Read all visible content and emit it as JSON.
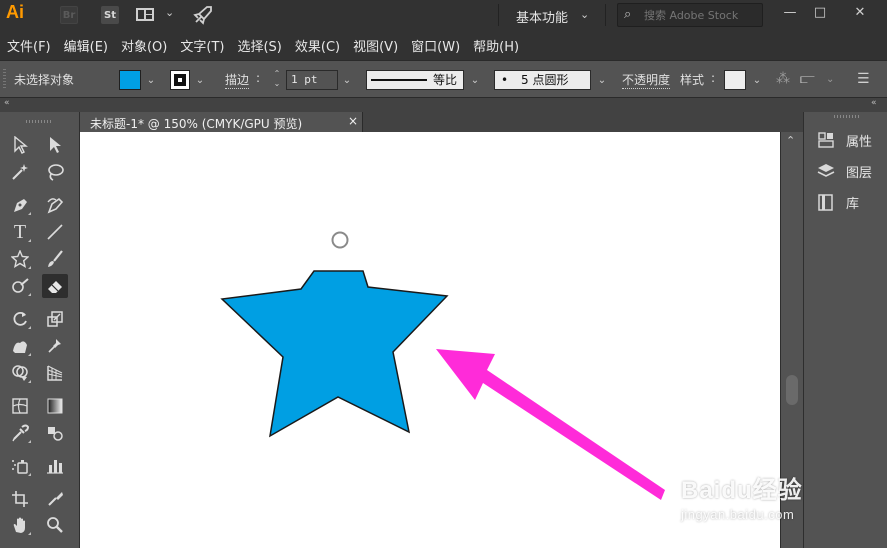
{
  "app": {
    "logo": "Ai",
    "bridge_label": "Br",
    "stock_label": "St",
    "workspace": "基本功能",
    "stock_search_placeholder": "搜索 Adobe Stock"
  },
  "menu": [
    "文件(F)",
    "编辑(E)",
    "对象(O)",
    "文字(T)",
    "选择(S)",
    "效果(C)",
    "视图(V)",
    "窗口(W)",
    "帮助(H)"
  ],
  "controlbar": {
    "selection_status": "未选择对象",
    "fill_color": "#009fe3",
    "stroke_label": "描边",
    "stroke_weight": "1 pt",
    "stroke_profile": "等比",
    "brush": "5 点圆形",
    "opacity_label": "不透明度",
    "style_label": "样式"
  },
  "document": {
    "tab_title": "未标题-1* @ 150% (CMYK/GPU 预览)",
    "close_symbol": "×"
  },
  "artwork": {
    "star_fill": "#009fe3",
    "star_stroke": "#1a1a1a",
    "arrow_color": "#ff2bd9"
  },
  "toolbar": {
    "tools": [
      "selection-tool",
      "direct-selection-tool",
      "magic-wand-tool",
      "lasso-tool",
      "pen-tool",
      "curvature-tool",
      "type-tool",
      "line-segment-tool",
      "star-tool",
      "paintbrush-tool",
      "shaper-tool",
      "eraser-tool",
      "rotate-tool",
      "scale-tool",
      "warp-tool",
      "puppet-warp-tool",
      "shape-builder-tool",
      "perspective-grid-tool",
      "mesh-tool",
      "gradient-tool",
      "eyedropper-tool",
      "blend-tool",
      "symbol-sprayer-tool",
      "column-graph-tool",
      "artboard-tool",
      "slice-tool",
      "hand-tool",
      "zoom-tool"
    ]
  },
  "dock": {
    "items": [
      {
        "label": "属性",
        "icon": "properties-icon"
      },
      {
        "label": "图层",
        "icon": "layers-icon"
      },
      {
        "label": "库",
        "icon": "libraries-icon"
      }
    ]
  },
  "watermark": {
    "brand": "Baidu经验",
    "url": "jingyan.baidu.com"
  }
}
